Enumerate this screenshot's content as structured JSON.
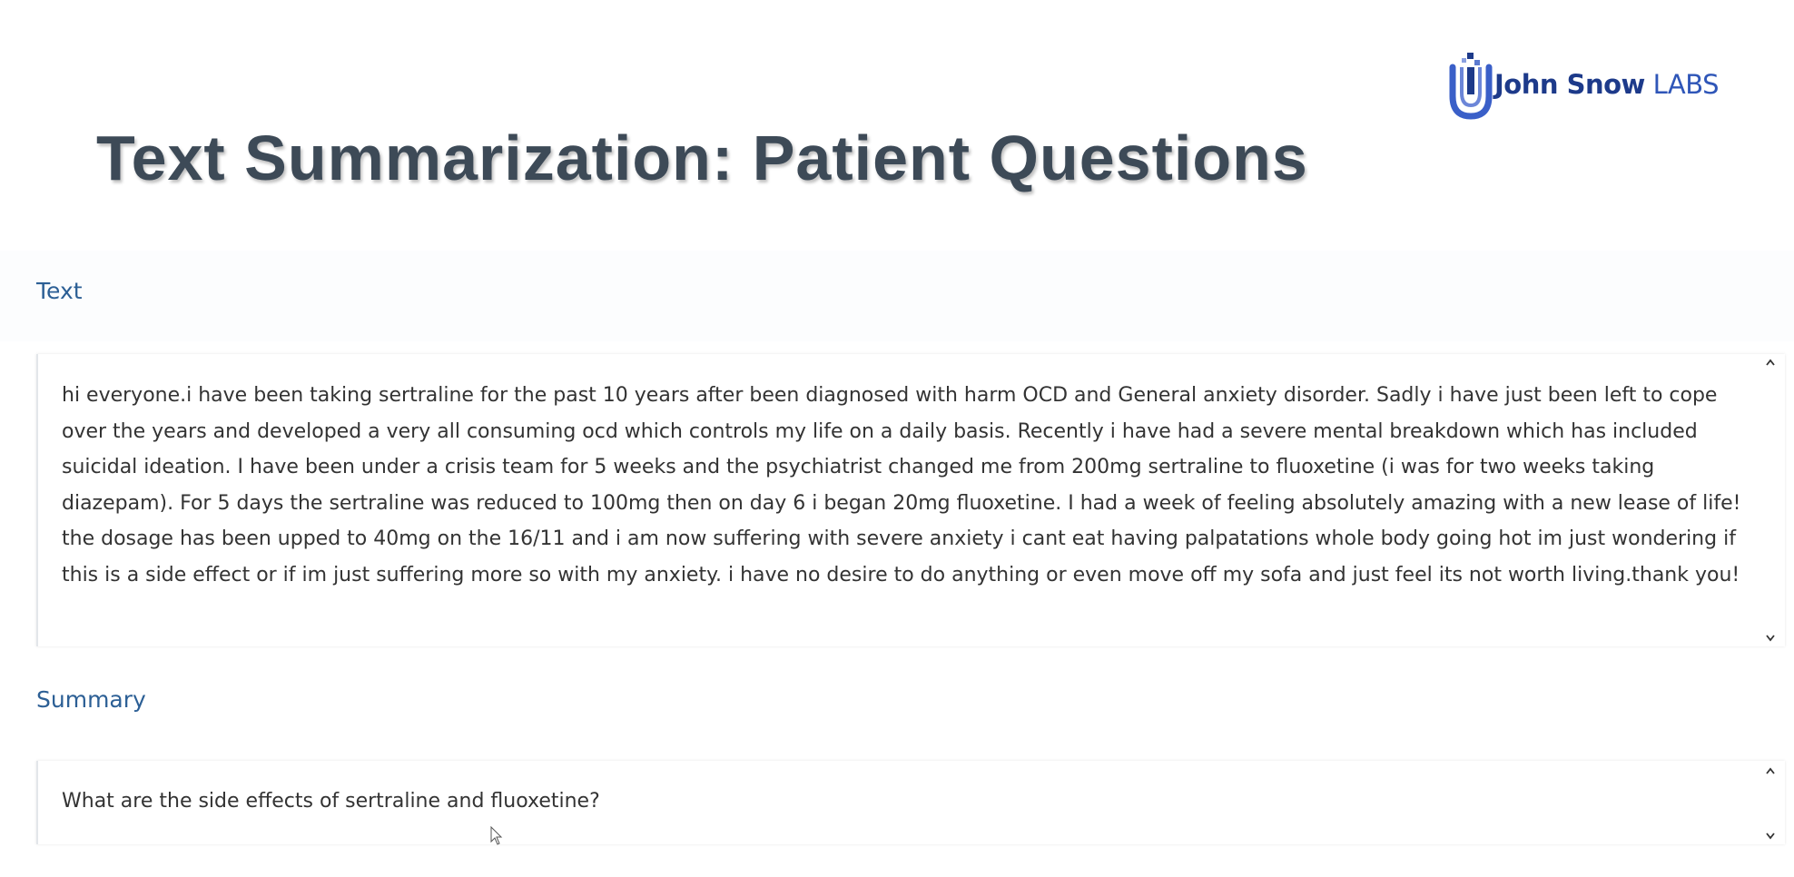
{
  "app": {
    "logo_text_1": "John Snow",
    "logo_text_2": "LABS",
    "title": "Text Summarization: Patient Questions"
  },
  "text_section": {
    "label": "Text",
    "content": "hi everyone.i have been taking sertraline for the past 10 years after been diagnosed with harm OCD and General anxiety disorder. Sadly i have just been left to cope over the years and developed a very all consuming ocd which controls my life on a daily basis. Recently i have had a severe mental breakdown which has included suicidal ideation. I have been under a crisis team for 5 weeks and the psychiatrist changed me from 200mg sertraline to fluoxetine (i was for two weeks taking diazepam). For 5 days the sertraline was reduced to 100mg then on day 6 i began 20mg fluoxetine. I had a week of feeling absolutely amazing with a new lease of life! the dosage has been upped to 40mg on the 16/11  and i am now suffering with severe anxiety i cant eat having palpatations whole body going hot im just wondering if this is a side effect or if im just suffering more so with my anxiety. i have no desire to do anything or even move off my sofa and just feel its not worth living.thank you!"
  },
  "summary_section": {
    "label": "Summary",
    "content": "What are the side effects of sertraline and fluoxetine?"
  },
  "colors": {
    "title": "#3d4a57",
    "section_label": "#2c5f95",
    "logo_primary": "#1d3a8a",
    "logo_accent": "#2f56b8"
  },
  "icons": [
    "john-snow-labs-logo-icon",
    "scroll-up-icon",
    "scroll-down-icon",
    "mouse-cursor-icon"
  ]
}
